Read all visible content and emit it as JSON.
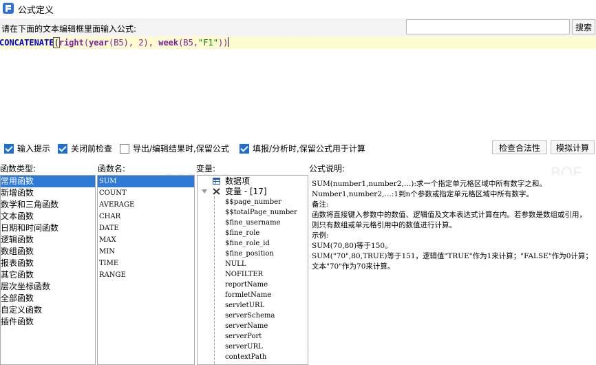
{
  "window": {
    "title": "公式定义"
  },
  "prompt": {
    "label": "请在下面的文本编辑框里面输入公式:",
    "search_placeholder": "",
    "search_button": "搜索"
  },
  "editor": {
    "formula_parts": {
      "fn1": "CONCATENATE",
      "open1": "(",
      "fn2": "right",
      "p2": "(",
      "fn3": "year",
      "arg1": "(B5), 2), ",
      "fn4": "week",
      "arg2": "(B5,",
      "str1": "\"F1\"",
      "close": "))"
    }
  },
  "options": {
    "input_hint": "输入提示",
    "check_on_close": "关闭前检查",
    "export_keep": "导出/编辑结果时,保留公式",
    "fill_keep": "填报/分析时,保留公式用于计算",
    "check_button": "检查合法性",
    "simulate_button": "模拟计算"
  },
  "labels": {
    "func_type": "函数类型:",
    "func_name": "函数名:",
    "variable": "变量:",
    "formula_desc": "公式说明:"
  },
  "categories": [
    "常用函数",
    "新增函数",
    "数学和三角函数",
    "文本函数",
    "日期和时间函数",
    "逻辑函数",
    "数组函数",
    "报表函数",
    "其它函数",
    "层次坐标函数",
    "全部函数",
    "自定义函数",
    "插件函数"
  ],
  "functions": [
    "SUM",
    "COUNT",
    "AVERAGE",
    "CHAR",
    "DATE",
    "MAX",
    "MIN",
    "TIME",
    "RANGE"
  ],
  "tree": {
    "data_item": "数据项",
    "variable_group": "变量 - [17]",
    "variables": [
      "$$page_number",
      "$$totalPage_number",
      "$fine_username",
      "$fine_role",
      "$fine_role_id",
      "$fine_position",
      "NULL",
      "NOFILTER",
      "reportName",
      "formletName",
      "servletURL",
      "serverSchema",
      "serverName",
      "serverPort",
      "serverURL",
      "contextPath"
    ]
  },
  "description": "SUM(number1,number2,…):求一个指定单元格区域中所有数字之和。\nNumber1,number2,…:1到n个参数或指定单元格区域中所有数字。\n备注:\n函数将直接键入参数中的数值、逻辑值及文本表达式计算在内。若参数是数组或引用，则只有数组或单元格引用中的数值进行计算。\n示例:\nSUM(70,80)等于150。\nSUM(\"70\",80,TRUE)等于151，逻辑值\"TRUE\"作为1来计算；\"FALSE\"作为0计算；文本\"70\"作为70来计算。",
  "colors": {
    "selection": "#2f7ad6",
    "keyword": "#0000cc",
    "fn": "#7a1fa2",
    "string": "#008000",
    "formula_highlight": "#fffbd1"
  }
}
